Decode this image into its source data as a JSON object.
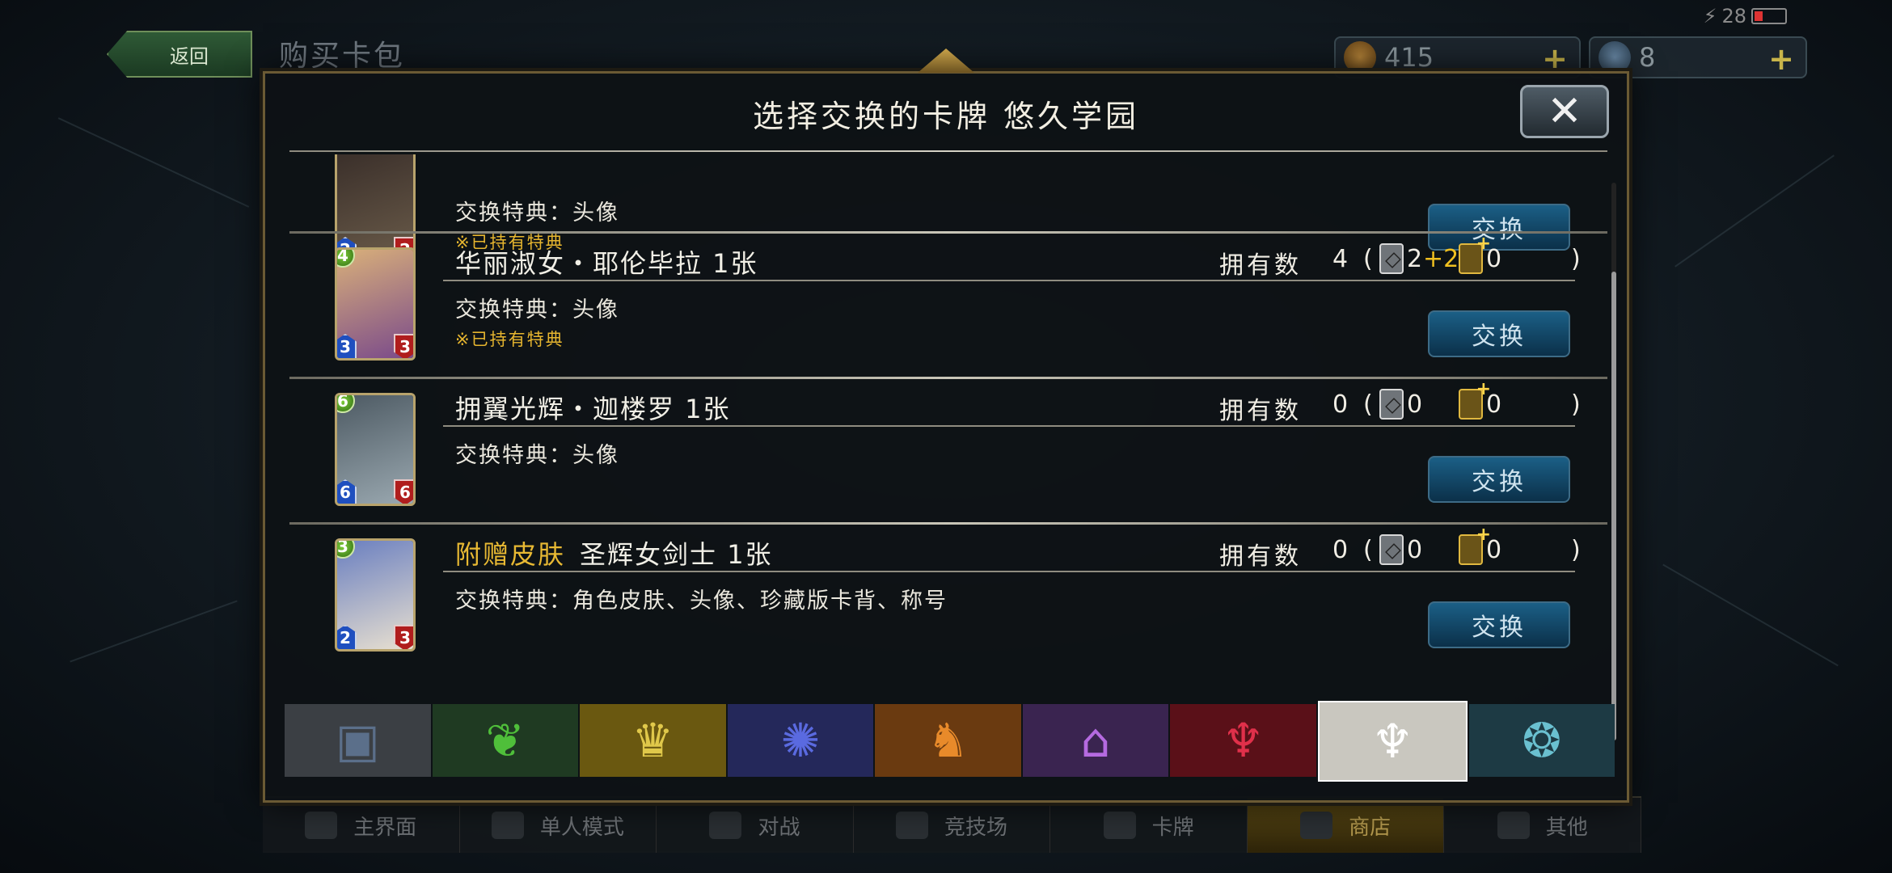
{
  "status_bar": {
    "battery": "28"
  },
  "top": {
    "back_label": "返回",
    "page_title": "购买卡包",
    "currency_gold": "415",
    "currency_crystal": "8",
    "plus": "+"
  },
  "modal": {
    "title": "选择交换的卡牌 悠久学园",
    "close_glyph": "✕",
    "rows": [
      {
        "name": "",
        "skin_tag": "",
        "benefit": "交换特典：头像",
        "owned_note": "※已持有特典",
        "cost": "",
        "atk": "2",
        "def": "2",
        "owned_label": "",
        "owned_count": "",
        "normal": "",
        "plus_count": "",
        "premium": "",
        "exchange_label": "交换",
        "art_colors": [
          "#3a2f2a",
          "#6b5c4a"
        ]
      },
      {
        "name": "华丽淑女・耶伦毕拉 1张",
        "skin_tag": "",
        "benefit": "交换特典：头像",
        "owned_note": "※已持有特典",
        "cost": "4",
        "atk": "3",
        "def": "3",
        "owned_label": "拥有数",
        "owned_count": "4",
        "normal": "2",
        "plus_count": "+2",
        "premium": "0",
        "exchange_label": "交换",
        "art_colors": [
          "#d9b07a",
          "#7a4a8a"
        ]
      },
      {
        "name": "拥翼光辉・迦楼罗 1张",
        "skin_tag": "",
        "benefit": "交换特典：头像",
        "owned_note": "",
        "cost": "6",
        "atk": "6",
        "def": "6",
        "owned_label": "拥有数",
        "owned_count": "0",
        "normal": "0",
        "plus_count": "",
        "premium": "0",
        "exchange_label": "交换",
        "art_colors": [
          "#4d5a63",
          "#9aa8b0"
        ]
      },
      {
        "name": "圣辉女剑士 1张",
        "skin_tag": "附赠皮肤",
        "benefit": "交换特典：角色皮肤、头像、珍藏版卡背、称号",
        "owned_note": "",
        "cost": "3",
        "atk": "2",
        "def": "3",
        "owned_label": "拥有数",
        "owned_count": "0",
        "normal": "0",
        "plus_count": "",
        "premium": "0",
        "exchange_label": "交换",
        "art_colors": [
          "#6a7fc0",
          "#e8e0d0"
        ]
      }
    ],
    "paren_open": "(",
    "paren_close": ")"
  },
  "class_tabs": [
    {
      "name": "neutral-card-icon",
      "glyph": "▣",
      "bg": "#3b3f44",
      "color": "#5b6f8a"
    },
    {
      "name": "forest-leaf-icon",
      "glyph": "❦",
      "bg": "#1f3a22",
      "color": "#4fbf3a"
    },
    {
      "name": "sword-crown-icon",
      "glyph": "♛",
      "bg": "#6a5810",
      "color": "#e0c84a"
    },
    {
      "name": "rune-star-icon",
      "glyph": "✺",
      "bg": "#24285a",
      "color": "#5a6ae0"
    },
    {
      "name": "dragon-icon",
      "glyph": "♞",
      "bg": "#6a3a10",
      "color": "#e88a2a"
    },
    {
      "name": "shadow-tombstone-icon",
      "glyph": "⌂",
      "bg": "#3a2450",
      "color": "#b56ae0"
    },
    {
      "name": "blood-wings-icon",
      "glyph": "♆",
      "bg": "#5a1018",
      "color": "#e0304a"
    },
    {
      "name": "haven-wings-icon",
      "glyph": "♆",
      "bg": "#c9c7bf",
      "color": "#ffffff",
      "active": true
    },
    {
      "name": "portal-icon",
      "glyph": "❂",
      "bg": "#1d3a44",
      "color": "#6ac0d0"
    }
  ],
  "bottom_nav": [
    {
      "label": "主界面"
    },
    {
      "label": "单人模式"
    },
    {
      "label": "对战"
    },
    {
      "label": "竞技场"
    },
    {
      "label": "卡牌"
    },
    {
      "label": "商店",
      "active": true
    },
    {
      "label": "其他"
    }
  ]
}
